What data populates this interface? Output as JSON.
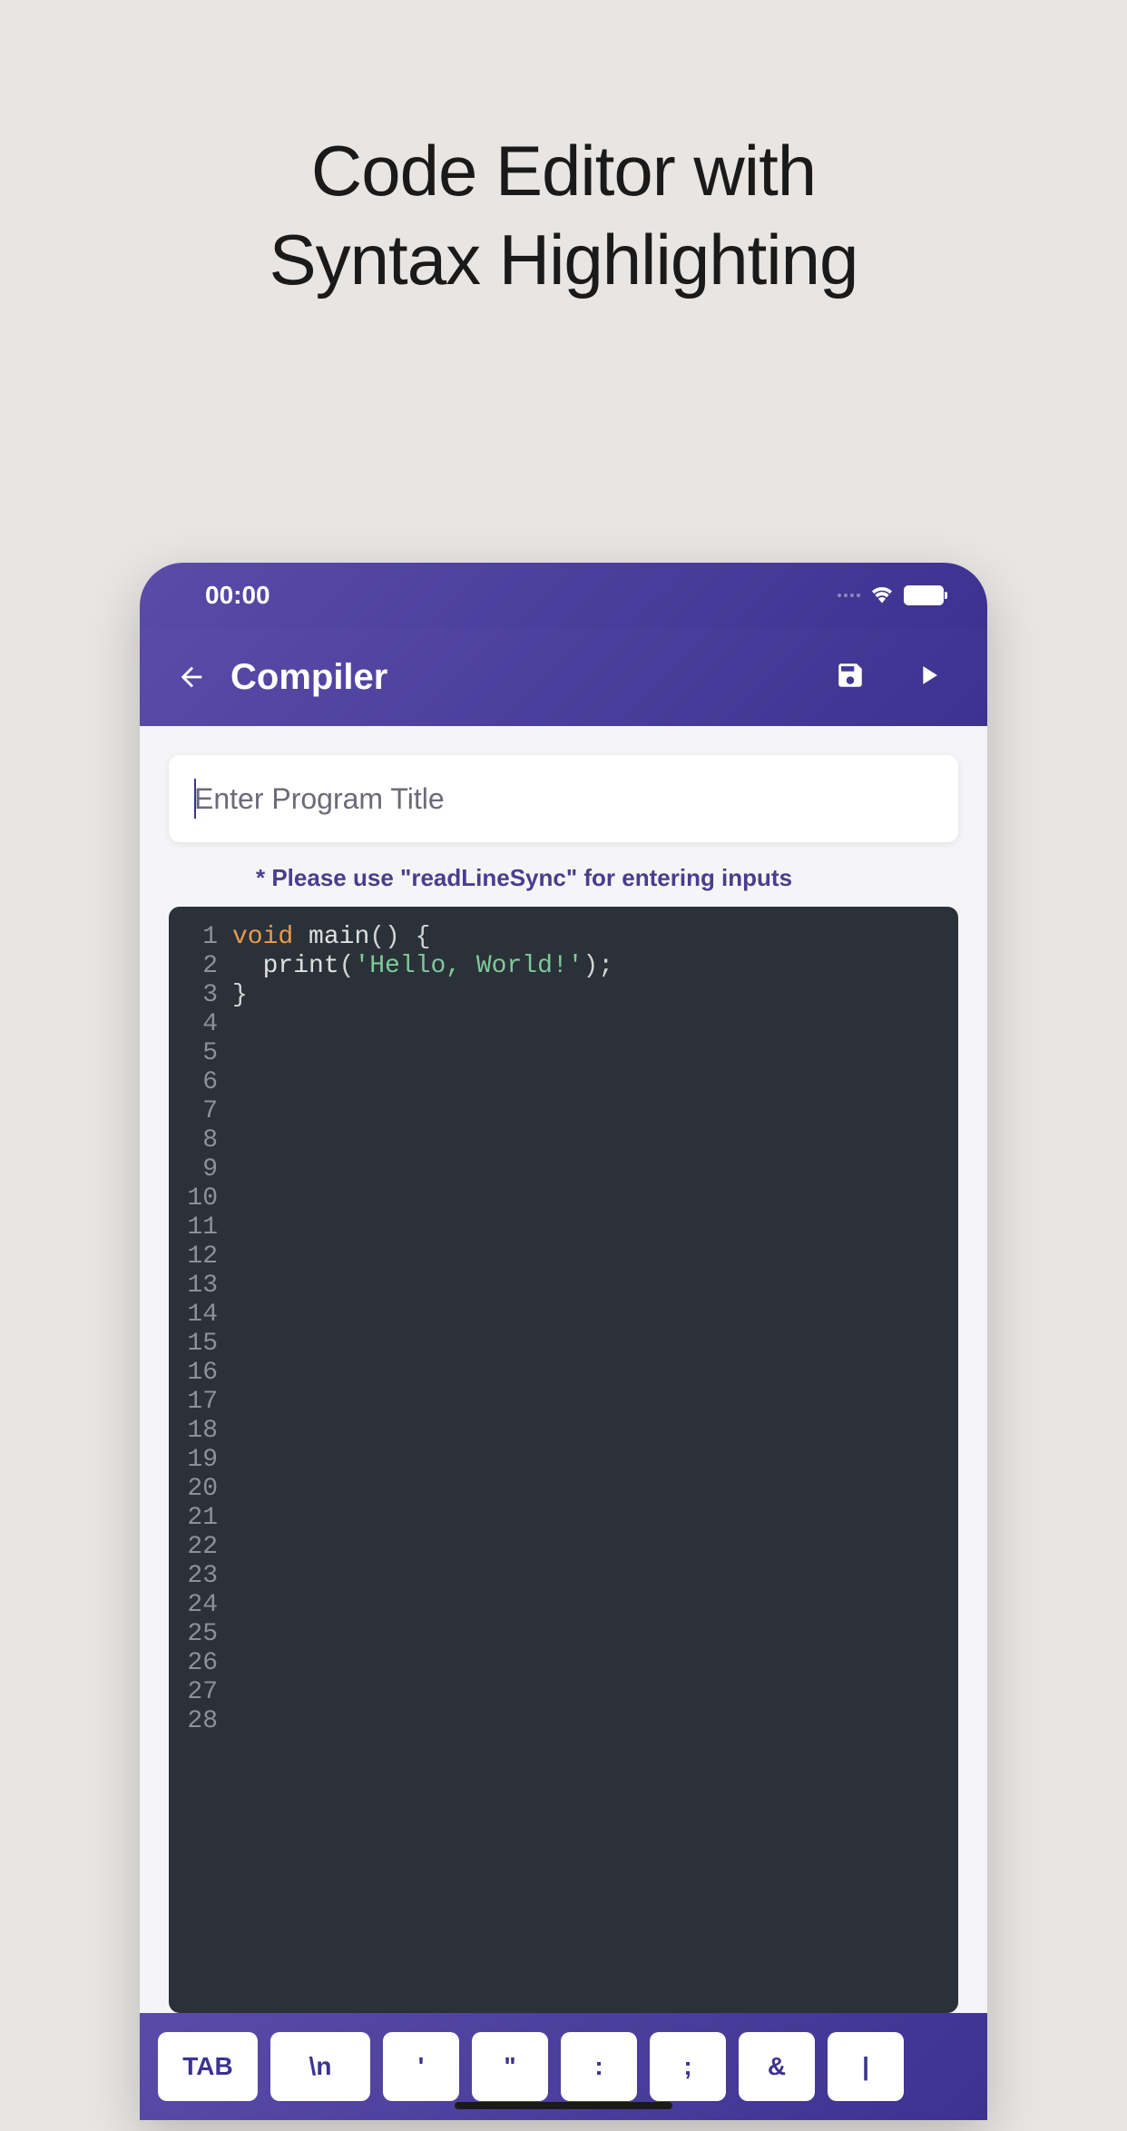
{
  "promo": {
    "title_line1": "Code Editor with",
    "title_line2": "Syntax Highlighting"
  },
  "status": {
    "time": "00:00"
  },
  "nav": {
    "title": "Compiler"
  },
  "title_input": {
    "placeholder": "Enter Program Title",
    "value": ""
  },
  "hint": "* Please use \"readLineSync\" for entering inputs",
  "code": {
    "total_lines": 28,
    "lines": [
      {
        "n": 1,
        "tokens": [
          {
            "cls": "tok-keyword",
            "t": "void"
          },
          {
            "cls": "",
            "t": " "
          },
          {
            "cls": "tok-func",
            "t": "main"
          },
          {
            "cls": "tok-punct",
            "t": "() {"
          }
        ]
      },
      {
        "n": 2,
        "tokens": [
          {
            "cls": "",
            "t": "  "
          },
          {
            "cls": "tok-func",
            "t": "print"
          },
          {
            "cls": "tok-punct",
            "t": "("
          },
          {
            "cls": "tok-string",
            "t": "'Hello, World!'"
          },
          {
            "cls": "tok-punct",
            "t": ");"
          }
        ]
      },
      {
        "n": 3,
        "tokens": [
          {
            "cls": "tok-punct",
            "t": "}"
          }
        ]
      }
    ]
  },
  "shortcuts": [
    "TAB",
    "\\n",
    "'",
    "\"",
    ":",
    ";",
    "&",
    "|"
  ]
}
